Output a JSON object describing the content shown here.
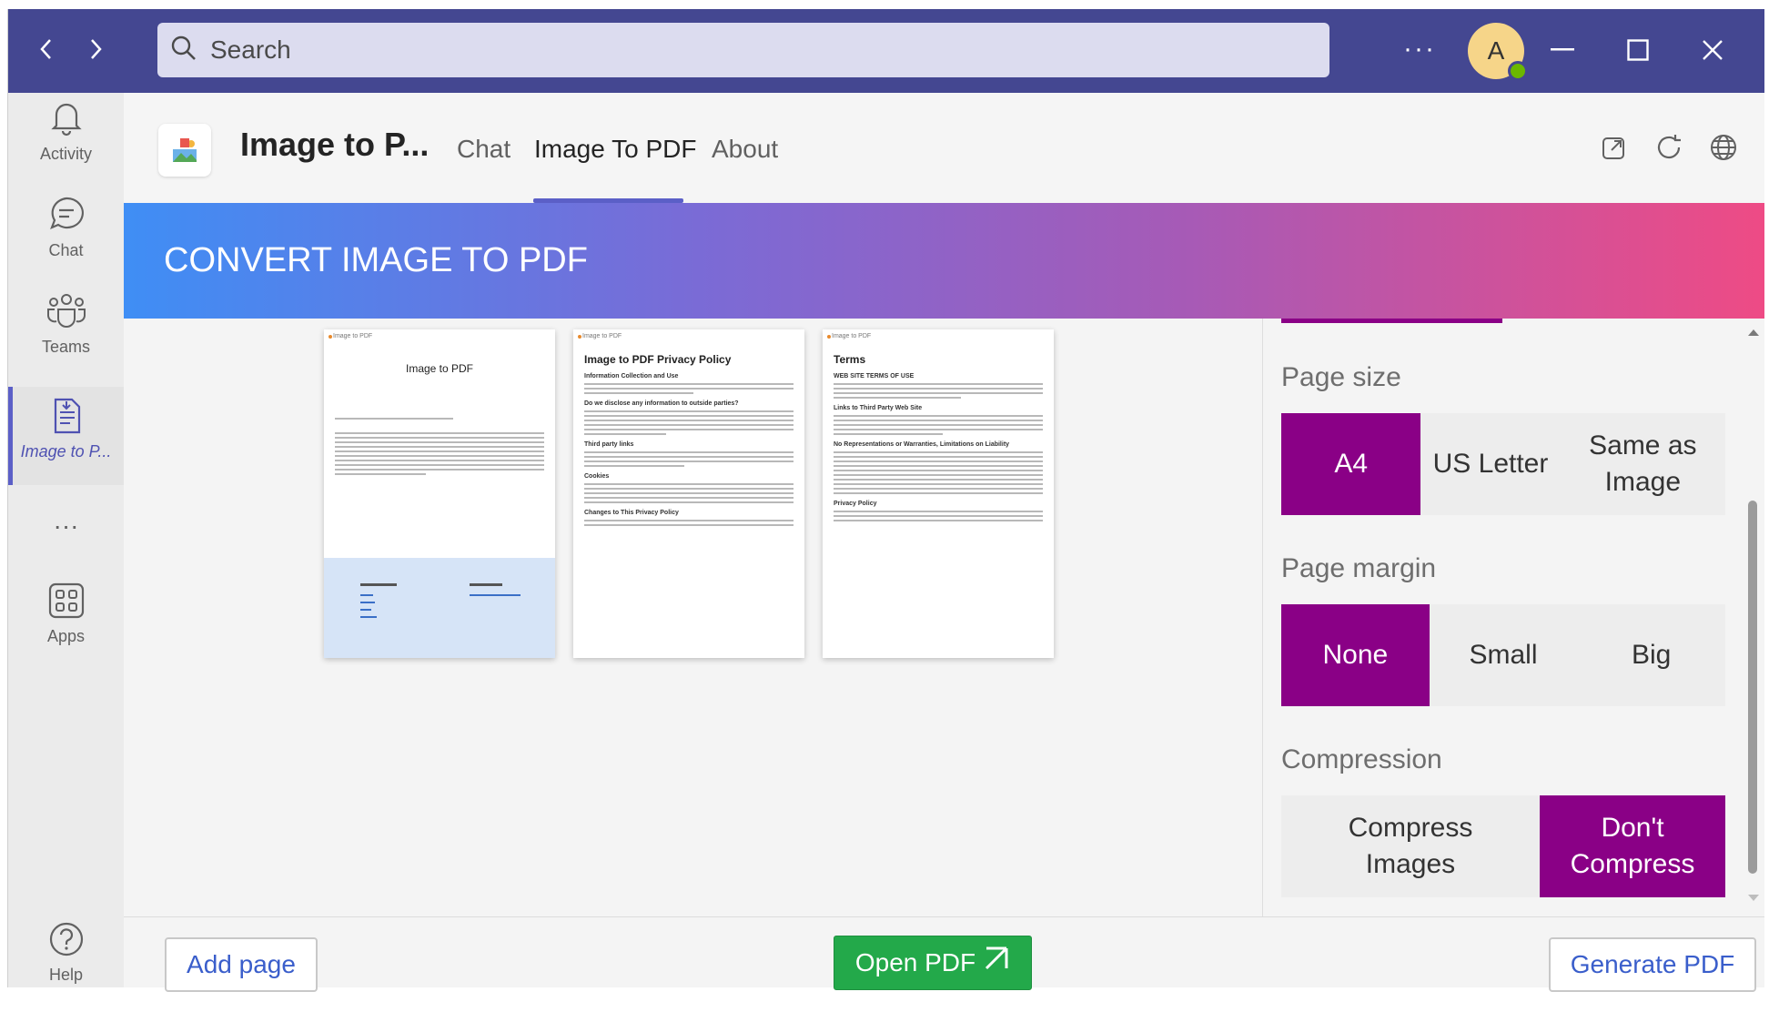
{
  "titlebar": {
    "search_placeholder": "Search",
    "more_label": "···",
    "avatar_initial": "A"
  },
  "rail": {
    "items": [
      {
        "label": "Activity",
        "icon": "bell-icon"
      },
      {
        "label": "Chat",
        "icon": "chat-icon"
      },
      {
        "label": "Teams",
        "icon": "teams-icon"
      },
      {
        "label": "Image to P...",
        "icon": "app-doc-icon"
      },
      {
        "label": "···",
        "icon": "more-icon"
      },
      {
        "label": "Apps",
        "icon": "apps-icon"
      },
      {
        "label": "Help",
        "icon": "help-icon"
      }
    ]
  },
  "header": {
    "app_title": "Image to P...",
    "tabs": [
      {
        "label": "Chat"
      },
      {
        "label": "Image To PDF",
        "active": true
      },
      {
        "label": "About"
      }
    ]
  },
  "banner": {
    "title": "CONVERT IMAGE TO PDF"
  },
  "pages": [
    {
      "header": "Image to PDF",
      "title": "Image to PDF"
    },
    {
      "header": "Image to PDF",
      "title": "Image to PDF Privacy Policy",
      "subs": [
        "Information Collection and Use",
        "Do we disclose any information to outside parties?",
        "Third party links",
        "Cookies",
        "Changes to This Privacy Policy"
      ]
    },
    {
      "header": "Image to PDF",
      "title": "Terms",
      "subs": [
        "WEB SITE TERMS OF USE",
        "Links to Third Party Web Site",
        "No Representations or Warranties, Limitations on Liability",
        "Privacy Policy"
      ]
    }
  ],
  "settings": {
    "page_size": {
      "label": "Page size",
      "options": [
        "A4",
        "US Letter",
        "Same as Image"
      ],
      "selected": "A4"
    },
    "page_margin": {
      "label": "Page margin",
      "options": [
        "None",
        "Small",
        "Big"
      ],
      "selected": "None"
    },
    "compression": {
      "label": "Compression",
      "options": [
        "Compress Images",
        "Don't Compress"
      ],
      "selected": "Don't Compress"
    }
  },
  "footer": {
    "add_page": "Add page",
    "open_pdf": "Open PDF",
    "generate_pdf": "Generate PDF"
  },
  "colors": {
    "titlebar": "#444791",
    "accent": "#5b5fc7",
    "selected_option": "#8a0086",
    "open_pdf_button": "#23a94a"
  }
}
